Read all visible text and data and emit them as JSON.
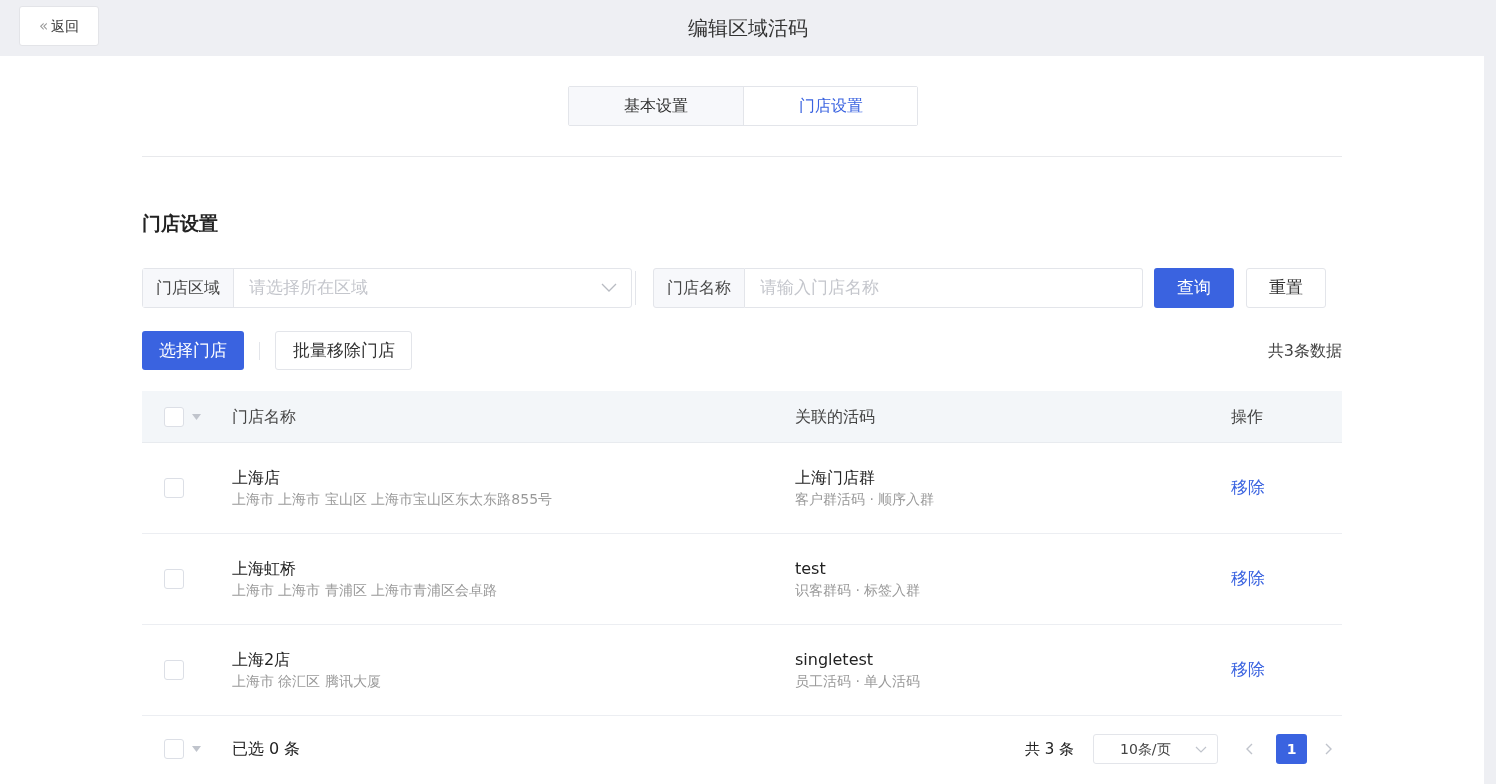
{
  "header": {
    "back_button": {
      "icon": "«",
      "label": "返回"
    },
    "title": "编辑区域活码"
  },
  "tabs": [
    {
      "label": "基本设置",
      "selected": false
    },
    {
      "label": "门店设置",
      "selected": true
    }
  ],
  "section_title": "门店设置",
  "filters": {
    "region": {
      "label": "门店区域",
      "placeholder": "请选择所在区域"
    },
    "name": {
      "label": "门店名称",
      "placeholder": "请输入门店名称"
    },
    "search_button": "查询",
    "reset_button": "重置"
  },
  "actions": {
    "select_button": "选择门店",
    "batch_remove_button": "批量移除门店",
    "total": "共3条数据"
  },
  "table": {
    "select_all_checked": false,
    "columns": [
      "门店名称",
      "关联的活码",
      "操作"
    ],
    "rows": [
      {
        "checked": false,
        "store": "上海店",
        "address": "上海市 上海市 宝山区 上海市宝山区东太东路855号",
        "code": "上海门店群",
        "code_type": "客户群活码 · 顺序入群",
        "action": "移除"
      },
      {
        "checked": false,
        "store": "上海虹桥",
        "address": "上海市 上海市 青浦区 上海市青浦区会卓路",
        "code": "test",
        "code_type": "识客群码 · 标签入群",
        "action": "移除"
      },
      {
        "checked": false,
        "store": "上海2店",
        "address": "上海市 徐汇区 腾讯大厦",
        "code": "singletest",
        "code_type": "员工活码 · 单人活码",
        "action": "移除"
      }
    ]
  },
  "footer": {
    "select_all_checked": false,
    "selected_count": "已选 0 条",
    "total": "共 3 条",
    "page_size": "10条/页",
    "pages": [
      {
        "label": "1",
        "selected": true
      }
    ]
  }
}
